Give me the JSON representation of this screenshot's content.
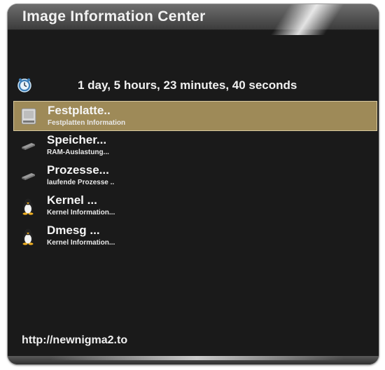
{
  "window": {
    "title": "Image Information Center"
  },
  "uptime": {
    "text": "1 day, 5 hours, 23 minutes, 40 seconds",
    "icon": "clock-icon"
  },
  "menu": {
    "items": [
      {
        "name": "Festplatte..",
        "desc": "Festplatten Information",
        "icon": "harddisk-icon",
        "selected": true
      },
      {
        "name": "Speicher...",
        "desc": "RAM-Auslastung...",
        "icon": "memory-icon",
        "selected": false
      },
      {
        "name": "Prozesse...",
        "desc": "laufende Prozesse ..",
        "icon": "process-icon",
        "selected": false
      },
      {
        "name": "Kernel ...",
        "desc": "Kernel Information...",
        "icon": "tux-icon",
        "selected": false
      },
      {
        "name": "Dmesg ...",
        "desc": "Kernel Information...",
        "icon": "tux-icon",
        "selected": false
      }
    ]
  },
  "footer": {
    "url": "http://newnigma2.to"
  },
  "colors": {
    "background": "#1a1a1a",
    "selection": "#9e8a58",
    "text": "#f0f0f0"
  }
}
